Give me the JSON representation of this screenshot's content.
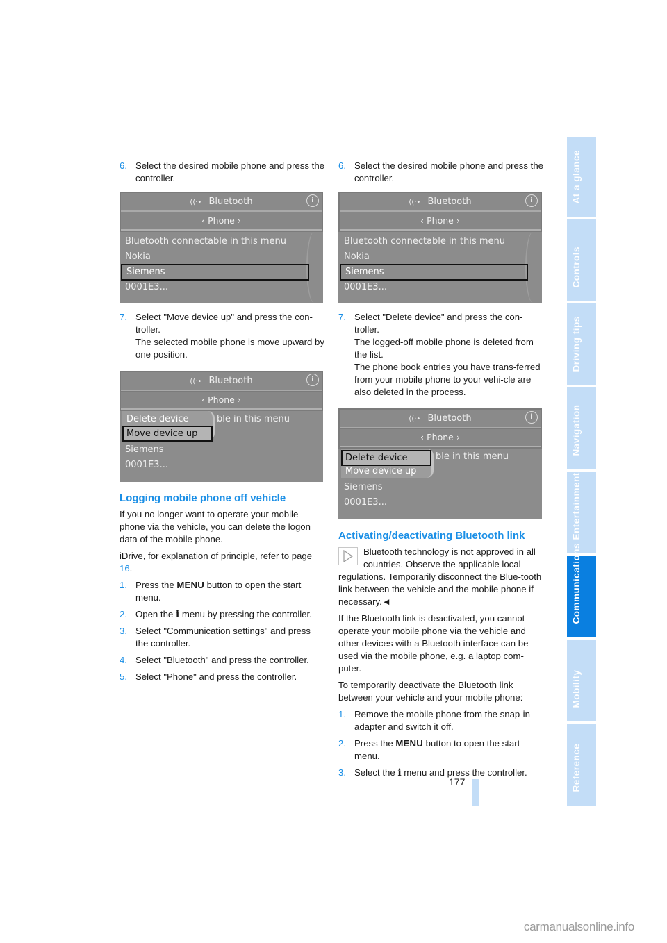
{
  "page_number": "177",
  "watermark": "carmanualsonline.info",
  "sidebar": {
    "tabs": [
      {
        "label": "At a glance",
        "active": false
      },
      {
        "label": "Controls",
        "active": false
      },
      {
        "label": "Driving tips",
        "active": false
      },
      {
        "label": "Navigation",
        "active": false
      },
      {
        "label": "Entertainment",
        "active": false
      },
      {
        "label": "Communications",
        "active": true
      },
      {
        "label": "Mobility",
        "active": false
      },
      {
        "label": "Reference",
        "active": false
      }
    ]
  },
  "left": {
    "step6": {
      "num": "6.",
      "text": "Select the desired mobile phone and press the controller."
    },
    "screen1": {
      "title": "Bluetooth",
      "tab": "‹ Phone ›",
      "items": [
        "Bluetooth connectable in this menu",
        "Nokia",
        "Siemens",
        "0001E3..."
      ],
      "selected": "Siemens"
    },
    "step7": {
      "num": "7.",
      "text": "Select \"Move device up\" and press the con-troller.",
      "sub": "The selected mobile phone is move upward by one position."
    },
    "screen2": {
      "title": "Bluetooth",
      "tab": "‹ Phone ›",
      "bg_item": "ble in this menu",
      "popup": [
        "Delete device",
        "Move device up"
      ],
      "popup_selected": "Move device up",
      "items": [
        "Siemens",
        "0001E3..."
      ]
    },
    "section": {
      "heading": "Logging mobile phone off vehicle",
      "intro": "If you no longer want to operate your mobile phone via the vehicle, you can delete the logon data of the mobile phone.",
      "idrive_ref_pre": "iDrive, for explanation of principle, refer to page ",
      "idrive_ref_page": "16",
      "idrive_ref_post": ".",
      "steps": [
        {
          "num": "1.",
          "pre": "Press the ",
          "bold": "MENU",
          "post": " button to open the start menu."
        },
        {
          "num": "2.",
          "pre": "Open the ",
          "icon": "i",
          "post": " menu by pressing the controller."
        },
        {
          "num": "3.",
          "text": "Select \"Communication settings\" and press the controller."
        },
        {
          "num": "4.",
          "text": "Select \"Bluetooth\" and press the controller."
        },
        {
          "num": "5.",
          "text": "Select \"Phone\" and press the controller."
        }
      ]
    }
  },
  "right": {
    "step6": {
      "num": "6.",
      "text": "Select the desired mobile phone and press the controller."
    },
    "screen1": {
      "title": "Bluetooth",
      "tab": "‹ Phone ›",
      "items": [
        "Bluetooth connectable in this menu",
        "Nokia",
        "Siemens",
        "0001E3..."
      ],
      "selected": "Siemens"
    },
    "step7": {
      "num": "7.",
      "text": "Select \"Delete device\" and press the con-troller.",
      "sub1": "The logged-off mobile phone is deleted from the list.",
      "sub2": "The phone book entries you have trans-ferred from your mobile phone to your vehi-cle are also deleted in the process."
    },
    "screen2": {
      "title": "Bluetooth",
      "tab": "‹ Phone ›",
      "bg_item": "ble in this menu",
      "popup": [
        "Delete device",
        "Move device up"
      ],
      "popup_selected": "Delete device",
      "items": [
        "Siemens",
        "0001E3..."
      ]
    },
    "section": {
      "heading": "Activating/deactivating Bluetooth link",
      "note": "Bluetooth technology is not approved in all countries. Observe the applicable local regulations. Temporarily disconnect the Blue-tooth link between the vehicle and the mobile phone if necessary.",
      "note_end": "◄",
      "para1": "If the Bluetooth link is deactivated, you cannot operate your mobile phone via the vehicle and other devices with a Bluetooth interface can be used via the mobile phone, e.g. a laptop com-puter.",
      "para2": "To temporarily deactivate the Bluetooth link between your vehicle and your mobile phone:",
      "steps": [
        {
          "num": "1.",
          "text": "Remove the mobile phone from the snap-in adapter and switch it off."
        },
        {
          "num": "2.",
          "pre": "Press the ",
          "bold": "MENU",
          "post": " button to open the start menu."
        },
        {
          "num": "3.",
          "pre": "Select the ",
          "icon": "i",
          "post": " menu and press the controller."
        }
      ]
    }
  }
}
